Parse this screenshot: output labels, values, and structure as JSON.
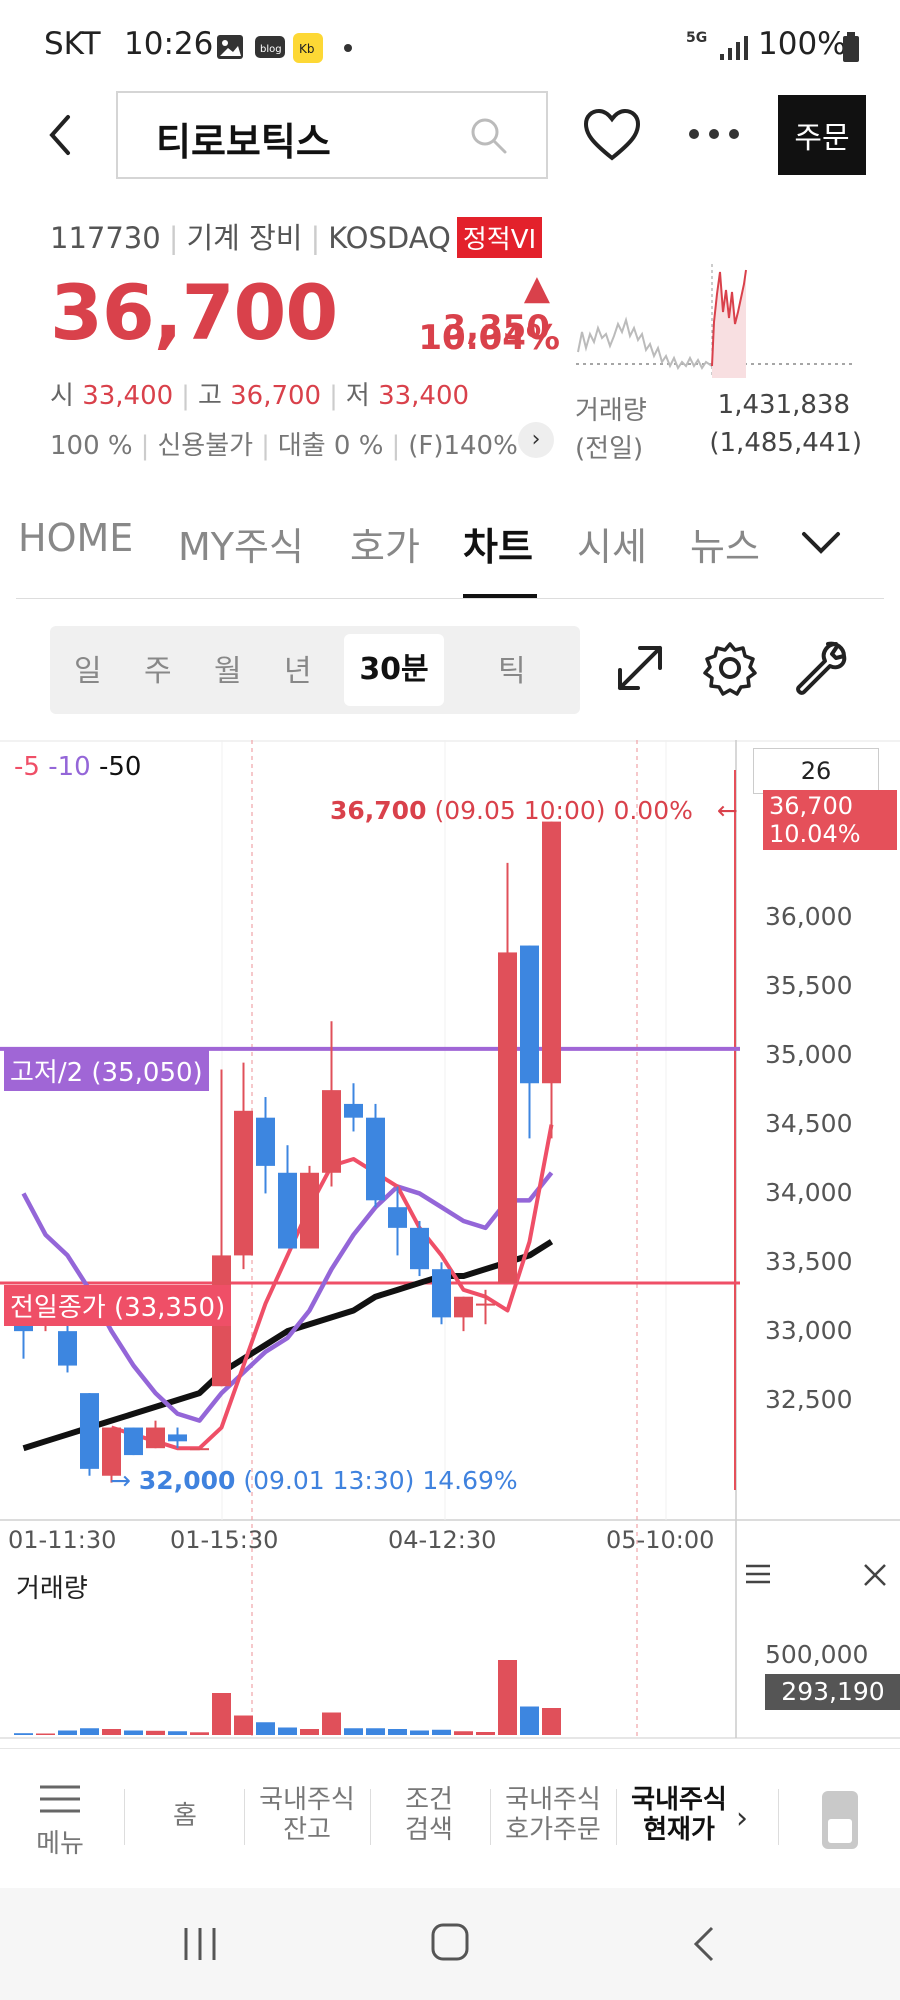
{
  "status_bar": {
    "carrier": "SKT",
    "time": "10:26",
    "network": "5G",
    "battery": "100%"
  },
  "header": {
    "stock_name": "티로보틱스",
    "order_button": "주문"
  },
  "stock_info": {
    "code": "117730",
    "sector": "기계 장비",
    "market": "KOSDAQ",
    "badge": "정적VI",
    "price": "36,700",
    "change": "▲ 3,350",
    "change_pct": "10.04%",
    "open_label": "시",
    "open": "33,400",
    "high_label": "고",
    "high": "36,700",
    "low_label": "저",
    "low": "33,400",
    "flag1": "100 %",
    "flag2": "신용불가",
    "flag3": "대출 0 %",
    "flag4": "(F)140%",
    "volume_label": "거래량",
    "volume": "1,431,838",
    "prev_label": "(전일)",
    "prev_volume": "(1,485,441)"
  },
  "tabs": {
    "items": [
      "HOME",
      "MY주식",
      "호가",
      "차트",
      "시세",
      "뉴스"
    ],
    "active": "차트"
  },
  "periods": {
    "items": [
      "일",
      "주",
      "월",
      "년",
      "30분",
      "틱"
    ],
    "active": "30분"
  },
  "chart": {
    "ma_legend": [
      "5",
      "10",
      "50"
    ],
    "count_box": "26",
    "current_tag_price": "36,700",
    "current_tag_pct": "10.04%",
    "high_note_price": "36,700",
    "high_note_rest": "(09.05 10:00) 0.00%",
    "low_note_price": "32,000",
    "low_note_rest": "(09.01 13:30) 14.69%",
    "line_purple_label": "고저/2 (35,050)",
    "line_red_label": "전일종가 (33,350)",
    "price_ticks": [
      "36,000",
      "35,500",
      "35,000",
      "34,500",
      "34,000",
      "33,500",
      "33,000",
      "32,500"
    ],
    "time_ticks": [
      "01-11:30",
      "01-15:30",
      "04-12:30",
      "05-10:00"
    ],
    "volume_label": "거래량",
    "volume_tick": "500,000",
    "volume_tag": "293,190",
    "colors": {
      "up": "#e0505a",
      "down": "#3d86e0",
      "ma5": "#ef4f67",
      "ma10": "#9466d8",
      "ma50": "#111111"
    }
  },
  "chart_data": {
    "type": "candlestick",
    "interval": "30분",
    "ylim": [
      32000,
      36800
    ],
    "candles": [
      {
        "o": 33200,
        "h": 33300,
        "l": 32800,
        "c": 33000
      },
      {
        "o": 33100,
        "h": 33200,
        "l": 33000,
        "c": 33100
      },
      {
        "o": 33000,
        "h": 33050,
        "l": 32700,
        "c": 32750
      },
      {
        "o": 32550,
        "h": 32550,
        "l": 31950,
        "c": 32000
      },
      {
        "o": 31950,
        "h": 32300,
        "l": 31900,
        "c": 32300
      },
      {
        "o": 32300,
        "h": 32300,
        "l": 32100,
        "c": 32100
      },
      {
        "o": 32150,
        "h": 32350,
        "l": 32150,
        "c": 32300
      },
      {
        "o": 32250,
        "h": 32300,
        "l": 32150,
        "c": 32200
      },
      {
        "o": 32150,
        "h": 32150,
        "l": 32150,
        "c": 32150
      },
      {
        "o": 32600,
        "h": 34900,
        "l": 32600,
        "c": 33550
      },
      {
        "o": 33550,
        "h": 34950,
        "l": 33450,
        "c": 34600
      },
      {
        "o": 34550,
        "h": 34700,
        "l": 34000,
        "c": 34200
      },
      {
        "o": 34150,
        "h": 34350,
        "l": 33600,
        "c": 33600
      },
      {
        "o": 33600,
        "h": 34200,
        "l": 33600,
        "c": 34150
      },
      {
        "o": 34150,
        "h": 35250,
        "l": 34050,
        "c": 34750
      },
      {
        "o": 34650,
        "h": 34800,
        "l": 34450,
        "c": 34550
      },
      {
        "o": 34550,
        "h": 34650,
        "l": 33900,
        "c": 33950
      },
      {
        "o": 33900,
        "h": 34050,
        "l": 33550,
        "c": 33750
      },
      {
        "o": 33750,
        "h": 33800,
        "l": 33400,
        "c": 33450
      },
      {
        "o": 33450,
        "h": 33500,
        "l": 33050,
        "c": 33100
      },
      {
        "o": 33100,
        "h": 33250,
        "l": 33000,
        "c": 33250
      },
      {
        "o": 33200,
        "h": 33300,
        "l": 33050,
        "c": 33200
      },
      {
        "o": 33350,
        "h": 36400,
        "l": 33350,
        "c": 35750
      },
      {
        "o": 35800,
        "h": 35800,
        "l": 34400,
        "c": 34800
      },
      {
        "o": 34800,
        "h": 36700,
        "l": 34400,
        "c": 36700
      }
    ],
    "ma5": [
      null,
      null,
      null,
      null,
      32300,
      32250,
      32200,
      32150,
      32150,
      32300,
      32750,
      33200,
      33550,
      33900,
      34200,
      34250,
      34150,
      34050,
      33750,
      33550,
      33300,
      33250,
      33150,
      33650,
      34500
    ],
    "ma10": [
      34000,
      33700,
      33550,
      33300,
      33000,
      32750,
      32550,
      32400,
      32350,
      32550,
      32700,
      32850,
      32950,
      33150,
      33450,
      33700,
      33900,
      34050,
      34000,
      33900,
      33800,
      33750,
      33950,
      33950,
      34150
    ],
    "ma50": [
      32150,
      32200,
      32250,
      32300,
      32350,
      32400,
      32450,
      32500,
      32550,
      32700,
      32800,
      32900,
      33000,
      33050,
      33100,
      33150,
      33250,
      33300,
      33350,
      33400,
      33400,
      33450,
      33500,
      33550,
      33650
    ],
    "volume": [
      12000,
      10000,
      30000,
      45000,
      40000,
      30000,
      28000,
      25000,
      18000,
      280000,
      130000,
      85000,
      50000,
      40000,
      150000,
      45000,
      45000,
      40000,
      30000,
      35000,
      25000,
      20000,
      500000,
      190000,
      180000
    ],
    "volume_ylim": [
      0,
      520000
    ]
  },
  "bottom_nav": {
    "menu": "메뉴",
    "items": [
      {
        "l1": "홈",
        "l2": ""
      },
      {
        "l1": "국내주식",
        "l2": "잔고"
      },
      {
        "l1": "조건",
        "l2": "검색"
      },
      {
        "l1": "국내주식",
        "l2": "호가주문"
      },
      {
        "l1": "국내주식",
        "l2": "현재가"
      }
    ]
  }
}
